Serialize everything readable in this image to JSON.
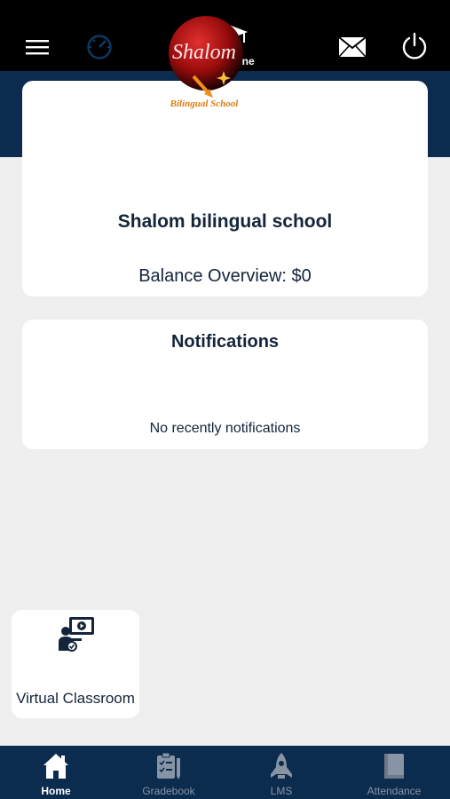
{
  "header": {
    "brand_name": "CollegeOne",
    "icons": [
      "menu-icon",
      "dashboard-icon",
      "mail-icon",
      "power-icon"
    ]
  },
  "school": {
    "logo_text_top": "Shalom",
    "logo_text_bottom": "Bilingual School",
    "name": "Shalom bilingual school",
    "balance": "Balance Overview: $0"
  },
  "notifications": {
    "title": "Notifications",
    "empty_message": "No recently notifications"
  },
  "shortcuts": {
    "virtual_classroom": "Virtual Classroom"
  },
  "bottom_nav": {
    "items": [
      {
        "label": "Home",
        "icon": "home-icon",
        "active": true
      },
      {
        "label": "Gradebook",
        "icon": "gradebook-icon",
        "active": false
      },
      {
        "label": "LMS",
        "icon": "rocket-icon",
        "active": false
      },
      {
        "label": "Attendance",
        "icon": "book-icon",
        "active": false
      }
    ]
  },
  "colors": {
    "topbar": "#000000",
    "navy": "#0b2b4f",
    "background": "#efefef",
    "text": "#14243a"
  }
}
